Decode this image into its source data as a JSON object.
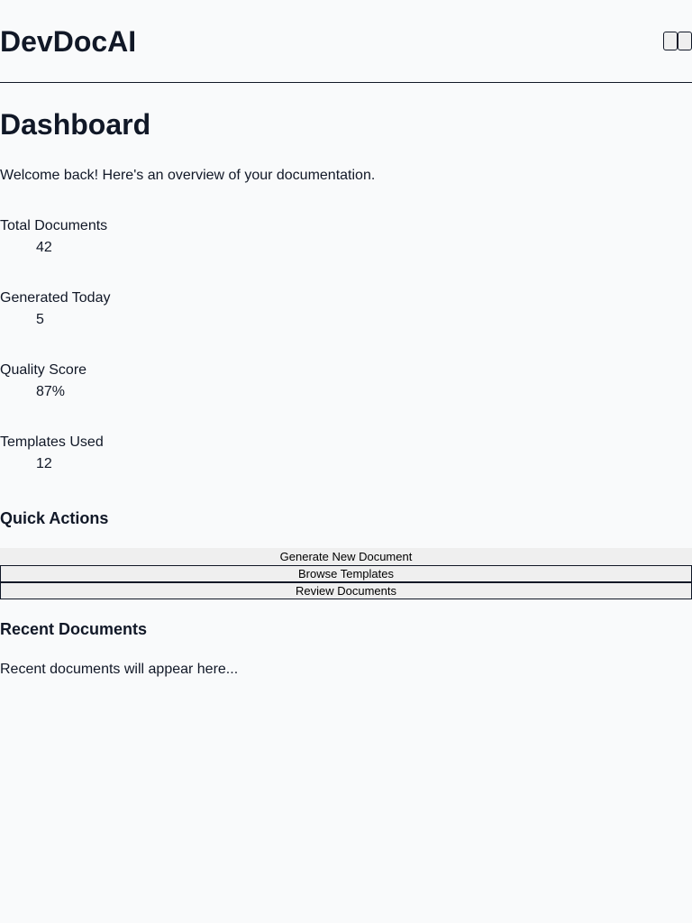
{
  "app": {
    "name": "DevDocAI"
  },
  "header": {
    "controls": [
      "",
      ""
    ]
  },
  "dashboard": {
    "title": "Dashboard",
    "welcome": "Welcome back! Here's an overview of your documentation."
  },
  "stats": [
    {
      "label": "Total Documents",
      "value": "42"
    },
    {
      "label": "Generated Today",
      "value": "5"
    },
    {
      "label": "Quality Score",
      "value": "87%"
    },
    {
      "label": "Templates Used",
      "value": "12"
    }
  ],
  "quick_actions": {
    "title": "Quick Actions",
    "buttons": [
      "Generate New Document",
      "Browse Templates",
      "Review Documents"
    ]
  },
  "recent_documents": {
    "title": "Recent Documents",
    "empty_text": "Recent documents will appear here..."
  },
  "colors": {
    "background": "#f9fafb",
    "text": "#111827",
    "button_background": "#efefef"
  }
}
